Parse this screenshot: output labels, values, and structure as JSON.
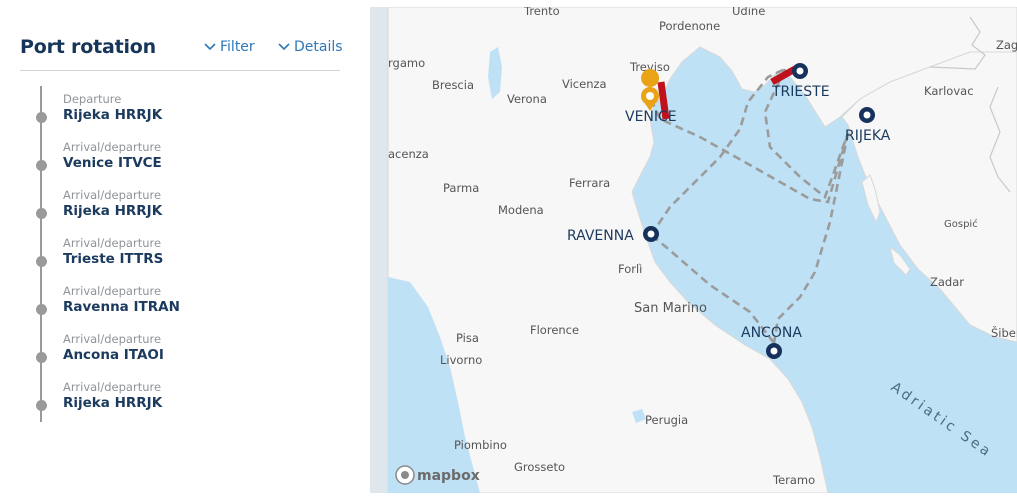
{
  "panel": {
    "title": "Port rotation",
    "filter_label": "Filter",
    "details_label": "Details"
  },
  "stops": [
    {
      "type": "Departure",
      "name": "Rijeka  HRRJK"
    },
    {
      "type": "Arrival/departure",
      "name": "Venice  ITVCE"
    },
    {
      "type": "Arrival/departure",
      "name": "Rijeka  HRRJK"
    },
    {
      "type": "Arrival/departure",
      "name": "Trieste  ITTRS"
    },
    {
      "type": "Arrival/departure",
      "name": "Ravenna  ITRAN"
    },
    {
      "type": "Arrival/departure",
      "name": "Ancona  ITAOI"
    },
    {
      "type": "Arrival/departure",
      "name": "Rijeka  HRRJK"
    }
  ],
  "map": {
    "ports": {
      "venice": "VENICE",
      "trieste": "TRIESTE",
      "rijeka": "RIJEKA",
      "ravenna": "RAVENNA",
      "ancona": "ANCONA"
    },
    "cities": {
      "trento": "Trento",
      "udine": "Udine",
      "pordenone": "Pordenone",
      "bergamo": "rgamo",
      "brescia": "Brescia",
      "verona": "Verona",
      "vicenza": "Vicenza",
      "treviso": "Treviso",
      "piacenza": "acenza",
      "ferrara": "Ferrara",
      "parma": "Parma",
      "modena": "Modena",
      "forli": "Forlì",
      "sanmarino": "San Marino",
      "pisa": "Pisa",
      "florence": "Florence",
      "livorno": "Livorno",
      "perugia": "Perugia",
      "piombino": "Piombino",
      "grosseto": "Grosseto",
      "teramo": "Teramo",
      "karlovac": "Karlovac",
      "gospic": "Gospić",
      "zadar": "Zadar",
      "sibenik": "Šiben",
      "zagreb": "Zag",
      "sea": "Adriatic Sea"
    },
    "attribution": "mapbox",
    "colors": {
      "water": "#bfe1f5",
      "land": "#f7f7f7",
      "route": "#9b9b9b",
      "port_marker": "#16325c",
      "origin_marker": "#e8a317",
      "highlight": "#c0121c"
    }
  }
}
